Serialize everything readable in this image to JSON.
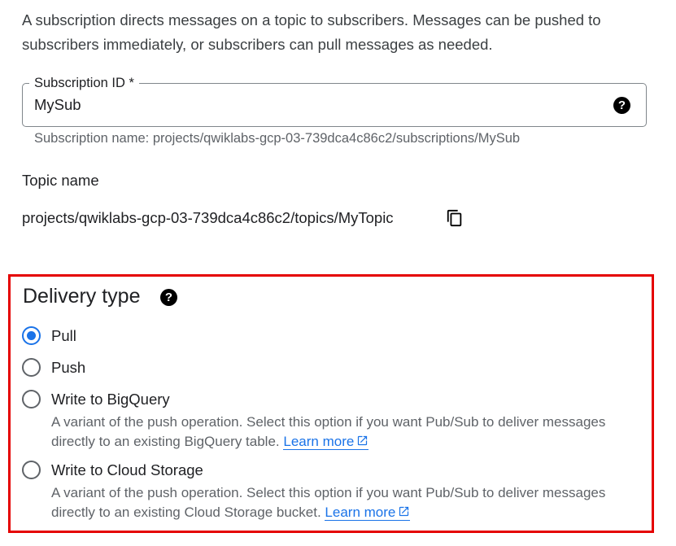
{
  "intro": {
    "text": "A subscription directs messages on a topic to subscribers. Messages can be pushed to subscribers immediately, or subscribers can pull messages as needed."
  },
  "subscription_id": {
    "label": "Subscription ID *",
    "value": "MySub",
    "hint": "Subscription name: projects/qwiklabs-gcp-03-739dca4c86c2/subscriptions/MySub"
  },
  "topic": {
    "label": "Topic name",
    "value": "projects/qwiklabs-gcp-03-739dca4c86c2/topics/MyTopic"
  },
  "delivery": {
    "title": "Delivery type",
    "selected": "Pull",
    "options": [
      {
        "label": "Pull",
        "description": "",
        "link": ""
      },
      {
        "label": "Push",
        "description": "",
        "link": ""
      },
      {
        "label": "Write to BigQuery",
        "description": "A variant of the push operation. Select this option if you want Pub/Sub to deliver messages directly to an existing BigQuery table.",
        "link": "Learn more"
      },
      {
        "label": "Write to Cloud Storage",
        "description": "A variant of the push operation. Select this option if you want Pub/Sub to deliver messages directly to an existing Cloud Storage bucket.",
        "link": "Learn more"
      }
    ]
  },
  "icons": {
    "help": "help-circle-icon",
    "copy": "copy-icon",
    "external_link": "open-in-new-icon"
  },
  "colors": {
    "accent": "#1a73e8",
    "highlight_border": "#e50000",
    "secondary_text": "#5f6368"
  }
}
